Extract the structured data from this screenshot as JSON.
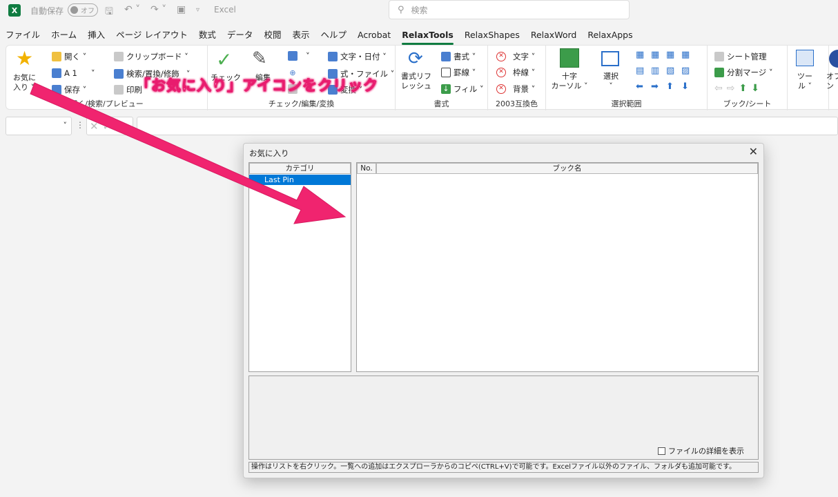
{
  "titlebar": {
    "logo": "X",
    "autosave_label": "自動保存",
    "toggle_state": "オフ",
    "app_name": "Excel",
    "search_placeholder": "検索"
  },
  "tabs": [
    {
      "label": "ファイル",
      "active": false
    },
    {
      "label": "ホーム",
      "active": false
    },
    {
      "label": "挿入",
      "active": false
    },
    {
      "label": "ページ レイアウト",
      "active": false
    },
    {
      "label": "数式",
      "active": false
    },
    {
      "label": "データ",
      "active": false
    },
    {
      "label": "校閲",
      "active": false
    },
    {
      "label": "表示",
      "active": false
    },
    {
      "label": "ヘルプ",
      "active": false
    },
    {
      "label": "Acrobat",
      "active": false
    },
    {
      "label": "RelaxTools",
      "active": true
    },
    {
      "label": "RelaxShapes",
      "active": false
    },
    {
      "label": "RelaxWord",
      "active": false
    },
    {
      "label": "RelaxApps",
      "active": false
    }
  ],
  "ribbon": {
    "g1": {
      "label": "開く/検索/プレビュー",
      "favorites_line1": "お気に",
      "favorites_line2": "入り ˅",
      "open": "開く ˅",
      "a1": "A 1",
      "save": "保存 ˅",
      "clipboard": "クリップボード ˅",
      "search_replace": "検索/置換/修飾",
      "print": "印刷"
    },
    "g2": {
      "label": "チェック/編集/変換",
      "check": "チェック",
      "edit": "編集",
      "text_date": "文字・日付 ˅",
      "formula_file": "式・ファイル ˅",
      "convert": "変換 ˅"
    },
    "g3": {
      "label": "書式",
      "refresh_line1": "書式リフ",
      "refresh_line2": "レッシュ",
      "format": "書式 ˅",
      "border": "罫線 ˅",
      "fill": "フィル ˅"
    },
    "g4": {
      "label": "2003互換色",
      "text": "文字 ˅",
      "frame": "枠線 ˅",
      "background": "背景 ˅"
    },
    "g5": {
      "label": "選択範囲",
      "cross_line1": "十字",
      "cross_line2": "カーソル ˅",
      "select": "選択"
    },
    "g6": {
      "label": "ブック/シート",
      "sheet_manage": "シート管理",
      "split_merge": "分割マージ ˅"
    },
    "g7": {
      "tool_line1": "ツー",
      "tool_line2": "ル ˅",
      "option_line1": "オプ",
      "option_line2": "ン"
    }
  },
  "formula_bar": {
    "namebox_value": "",
    "dots": "⋮",
    "cancel_glyph": "✕",
    "enter_glyph": "✓",
    "fx_glyph": "fx",
    "formula_value": ""
  },
  "dialog": {
    "title": "お気に入り",
    "close_glyph": "✕",
    "category_header": "カテゴリ",
    "category_item": "Last Pin",
    "no_header": "No.",
    "book_header": "ブック名",
    "detail_checkbox_label": "ファイルの詳細を表示",
    "status_text": "操作はリストを右クリック。一覧への追加はエクスプローラからのコピペ(CTRL+V)で可能です。Excelファイル以外のファイル、フォルダも追加可能です。"
  },
  "annotation": {
    "text": "「お気に入り」アイコンをクリック",
    "color": "#e81c6e"
  }
}
